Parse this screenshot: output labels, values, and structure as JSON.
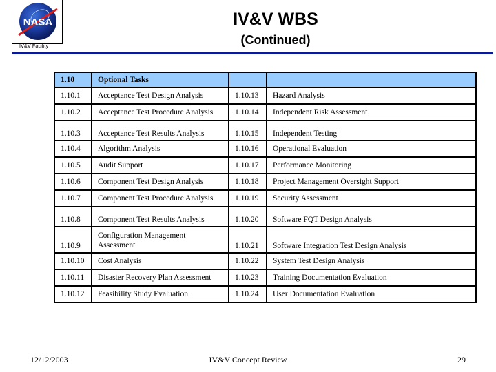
{
  "header": {
    "logo_text": "NASA",
    "facility_label": "IV&V Facility",
    "title": "IV&V WBS",
    "subtitle": "(Continued)",
    "accent_color": "#0a1a96"
  },
  "table": {
    "header_color": "#99ccff",
    "header": {
      "number": "1.10",
      "title": "Optional Tasks",
      "number2": "",
      "title2": ""
    },
    "rows": [
      {
        "left_num": "1.10.1",
        "left_task": "Acceptance Test Design Analysis",
        "right_num": "1.10.13",
        "right_task": "Hazard Analysis"
      },
      {
        "left_num": "1.10.2",
        "left_task": "Acceptance Test Procedure Analysis",
        "right_num": "1.10.14",
        "right_task": "Independent Risk Assessment"
      },
      {
        "left_num": "1.10.3",
        "left_task": "Acceptance Test Results Analysis",
        "right_num": "1.10.15",
        "right_task": "Independent Testing"
      },
      {
        "left_num": "1.10.4",
        "left_task": "Algorithm Analysis",
        "right_num": "1.10.16",
        "right_task": "Operational Evaluation"
      },
      {
        "left_num": "1.10.5",
        "left_task": "Audit Support",
        "right_num": "1.10.17",
        "right_task": "Performance Monitoring"
      },
      {
        "left_num": "1.10.6",
        "left_task": "Component Test Design Analysis",
        "right_num": "1.10.18",
        "right_task": "Project Management Oversight Support"
      },
      {
        "left_num": "1.10.7",
        "left_task": "Component Test Procedure Analysis",
        "right_num": "1.10.19",
        "right_task": "Security Assessment"
      },
      {
        "left_num": "1.10.8",
        "left_task": "Component Test Results Analysis",
        "right_num": "1.10.20",
        "right_task": "Software FQT Design Analysis"
      },
      {
        "left_num": "1.10.9",
        "left_task": "Configuration Management Assessment",
        "right_num": "1.10.21",
        "right_task": "Software Integration Test Design Analysis"
      },
      {
        "left_num": "1.10.10",
        "left_task": "Cost Analysis",
        "right_num": "1.10.22",
        "right_task": "System Test Design Analysis"
      },
      {
        "left_num": "1.10.11",
        "left_task": "Disaster Recovery Plan Assessment",
        "right_num": "1.10.23",
        "right_task": "Training Documentation Evaluation"
      },
      {
        "left_num": "1.10.12",
        "left_task": "Feasibility Study Evaluation",
        "right_num": "1.10.24",
        "right_task": "User Documentation Evaluation"
      }
    ]
  },
  "footer": {
    "date": "12/12/2003",
    "center": "IV&V Concept Review",
    "page": "29"
  }
}
